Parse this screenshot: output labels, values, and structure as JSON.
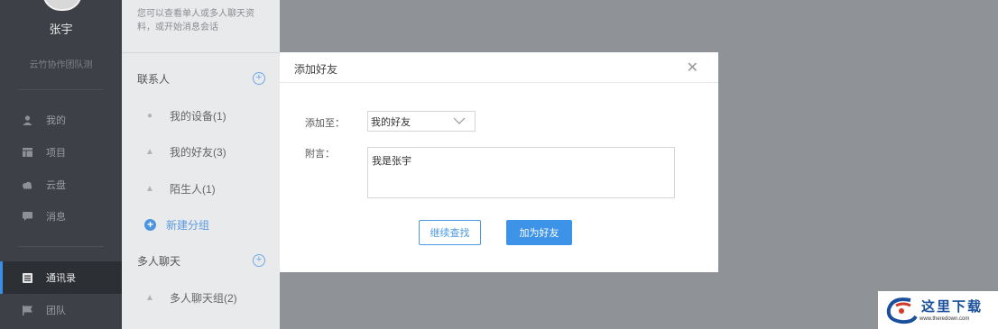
{
  "nav": {
    "user_name": "张宇",
    "team_name": "云竹协作团队测",
    "items": [
      {
        "label": "我的",
        "icon": "user-icon"
      },
      {
        "label": "项目",
        "icon": "project-icon"
      },
      {
        "label": "云盘",
        "icon": "cloud-icon"
      },
      {
        "label": "消息",
        "icon": "message-icon"
      },
      {
        "label": "通讯录",
        "icon": "contacts-icon",
        "active": true
      },
      {
        "label": "团队",
        "icon": "flag-icon"
      }
    ]
  },
  "contacts": {
    "hint": "您可以查看单人或多人聊天资料，或开始消息会话",
    "section_contacts": "联系人",
    "groups": [
      {
        "label": "我的设备(1)",
        "icon": "device-icon"
      },
      {
        "label": "我的好友(3)",
        "icon": "friends-icon"
      },
      {
        "label": "陌生人(1)",
        "icon": "stranger-icon"
      }
    ],
    "new_group": "新建分组",
    "section_group_chat": "多人聊天",
    "group_chat": {
      "label": "多人聊天组(2)",
      "icon": "group-chat-icon"
    }
  },
  "dialog": {
    "title": "添加好友",
    "add_to_label": "添加至：",
    "add_to_value": "我的好友",
    "message_label": "附言：",
    "message_value": "我是张宇",
    "continue_button": "继续查找",
    "add_button": "加为好友"
  },
  "watermark": {
    "text": "这里下载",
    "url": "www.theredown.com"
  },
  "colors": {
    "accent": "#3d93e8",
    "nav_bg": "#3d4147",
    "overlay": "#8f9296"
  }
}
